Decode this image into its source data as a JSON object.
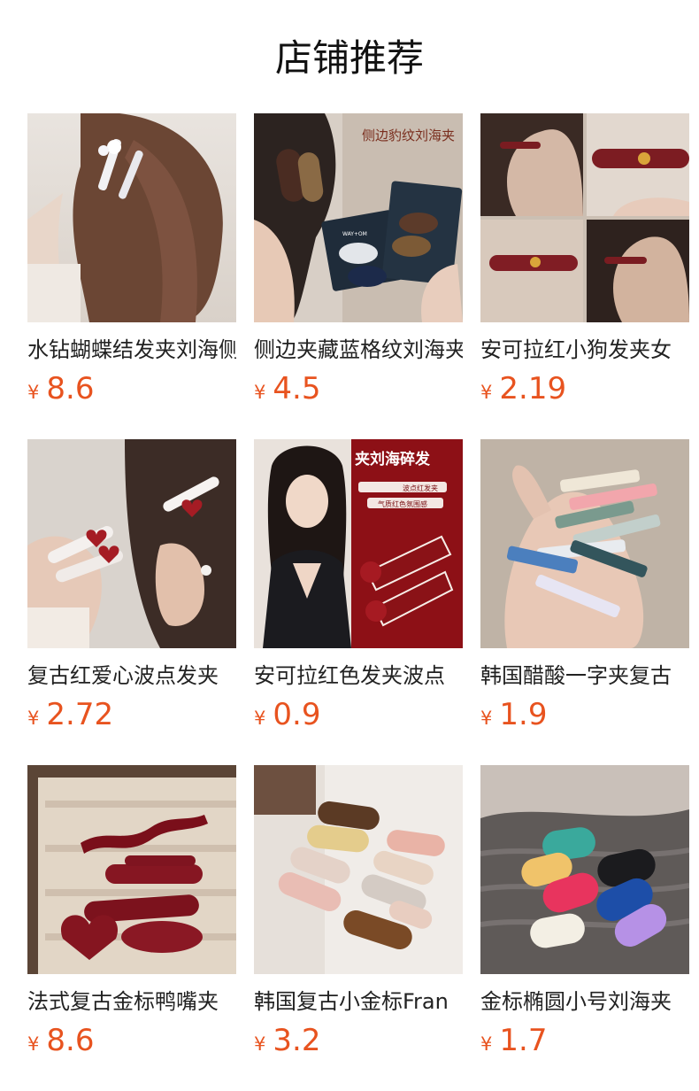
{
  "header": {
    "title": "店铺推荐"
  },
  "products": [
    {
      "name": "水钻蝴蝶结发夹刘海侧边夹",
      "currency": "¥",
      "price": "8.6",
      "image": "hair-with-rhinestone-bow-clips-photo"
    },
    {
      "name": "侧边夹藏蓝格纹刘海夹",
      "currency": "¥",
      "price": "4.5",
      "image": "leopard-plaid-clip-photo",
      "image_text": "侧边豹纹刘海夹",
      "card_text": "WAY+OM"
    },
    {
      "name": "安可拉红小狗发夹女",
      "currency": "¥",
      "price": "2.19",
      "image": "red-puppy-clip-collage-photo"
    },
    {
      "name": "复古红爱心波点发夹",
      "currency": "¥",
      "price": "2.72",
      "image": "red-heart-polka-dot-clip-photo"
    },
    {
      "name": "安可拉红色发夹波点",
      "currency": "¥",
      "price": "0.9",
      "image": "model-red-polka-dot-clip-photo",
      "image_text": "夹刘海碎发",
      "image_tag_1": "波点红发夹",
      "image_tag_2": "气质红色氛围感"
    },
    {
      "name": "韩国醋酸一字夹复古",
      "currency": "¥",
      "price": "1.9",
      "image": "hand-holding-acetate-bar-clips-photo"
    },
    {
      "name": "法式复古金标鸭嘴夹",
      "currency": "¥",
      "price": "8.6",
      "image": "burgundy-duckbill-clips-tray-photo"
    },
    {
      "name": "韩国复古小金标Fran",
      "currency": "¥",
      "price": "3.2",
      "image": "tortoiseshell-snap-clips-photo"
    },
    {
      "name": "金标椭圆小号刘海夹",
      "currency": "¥",
      "price": "1.7",
      "image": "colorful-oval-clips-on-knit-photo"
    }
  ],
  "colors": {
    "price": "#e8531f",
    "title": "#111111",
    "name": "#222222"
  }
}
